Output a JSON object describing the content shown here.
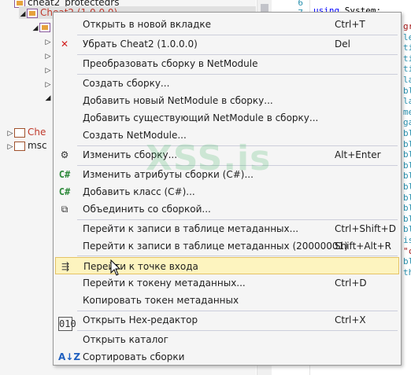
{
  "tree": {
    "nodes": [
      {
        "label": "cheat2_protectedrs",
        "glyph": "",
        "icon": "asm",
        "indent": 0,
        "color": "normal"
      },
      {
        "label": "Cheat2 (1.0.0.0)",
        "glyph": "◢",
        "icon": "asm",
        "indent": 1,
        "color": "red"
      },
      {
        "label": "",
        "glyph": "◢",
        "icon": "asm",
        "indent": 2,
        "color": "normal"
      },
      {
        "label": "",
        "glyph": "▷",
        "icon": "ns",
        "indent": 3,
        "color": "normal"
      },
      {
        "label": "",
        "glyph": "▷",
        "icon": "ns",
        "indent": 3,
        "color": "normal"
      },
      {
        "label": "",
        "glyph": "▷",
        "icon": "ns",
        "indent": 3,
        "color": "normal"
      },
      {
        "label": "",
        "glyph": "▷",
        "icon": "ns",
        "indent": 3,
        "color": "normal"
      },
      {
        "label": "",
        "glyph": "◢",
        "icon": "ns",
        "indent": 3,
        "color": "normal"
      },
      {
        "label": "Che",
        "glyph": "▷",
        "icon": "brown",
        "indent": 0,
        "color": "red"
      },
      {
        "label": "msc",
        "glyph": "▷",
        "icon": "brown",
        "indent": 0,
        "color": "normal"
      }
    ]
  },
  "code": {
    "line_numbers": [
      "6",
      "7"
    ],
    "top_line": {
      "keyword": "using",
      "rest": " System;"
    },
    "fragments": [
      {
        "text": "gr",
        "color": "#a31515"
      },
      {
        "text": "le",
        "color": "#2b91af"
      },
      {
        "text": "ti",
        "color": "#2b91af"
      },
      {
        "text": "ti",
        "color": "#2b91af"
      },
      {
        "text": "ti",
        "color": "#2b91af"
      },
      {
        "text": "la",
        "color": "#2b91af"
      },
      {
        "text": "bl",
        "color": "#2b91af"
      },
      {
        "text": "la",
        "color": "#2b91af"
      },
      {
        "text": "me",
        "color": "#2b91af"
      },
      {
        "text": "ga",
        "color": "#2b91af"
      },
      {
        "text": "bl",
        "color": "#2b91af"
      },
      {
        "text": "bl",
        "color": "#2b91af"
      },
      {
        "text": "bl",
        "color": "#2b91af"
      },
      {
        "text": "bl",
        "color": "#2b91af"
      },
      {
        "text": "bl",
        "color": "#2b91af"
      },
      {
        "text": "bl",
        "color": "#2b91af"
      },
      {
        "text": "bl",
        "color": "#2b91af"
      },
      {
        "text": "bl",
        "color": "#2b91af"
      },
      {
        "text": "bl",
        "color": "#2b91af"
      },
      {
        "text": "bl",
        "color": "#2b91af"
      },
      {
        "text": "is",
        "color": "#2b91af"
      },
      {
        "text": "\"c",
        "color": "#a31515"
      },
      {
        "text": "bl",
        "color": "#2b91af"
      },
      {
        "text": "th",
        "color": "#2b91af"
      }
    ]
  },
  "watermark": "XSS.is",
  "menu": {
    "items": [
      {
        "label": "Открыть в новой вкладке",
        "shortcut": "Ctrl+T",
        "icon": "",
        "highlight": false
      },
      {
        "label": "Убрать Cheat2 (1.0.0.0)",
        "shortcut": "Del",
        "icon": "✕",
        "highlight": false
      },
      {
        "label": "Преобразовать сборку в NetModule",
        "shortcut": "",
        "icon": "",
        "highlight": false
      },
      {
        "label": "Создать сборку...",
        "shortcut": "",
        "icon": "",
        "highlight": false
      },
      {
        "label": "Добавить новый NetModule в сборку...",
        "shortcut": "",
        "icon": "",
        "highlight": false
      },
      {
        "label": "Добавить существующий NetModule в сборку...",
        "shortcut": "",
        "icon": "",
        "highlight": false
      },
      {
        "label": "Создать NetModule...",
        "shortcut": "",
        "icon": "",
        "highlight": false
      },
      {
        "label": "Изменить сборку...",
        "shortcut": "Alt+Enter",
        "icon": "⚙",
        "highlight": false
      },
      {
        "label": "Изменить атрибуты сборки (C#)...",
        "shortcut": "",
        "icon": "C#",
        "highlight": false
      },
      {
        "label": "Добавить класс (C#)...",
        "shortcut": "",
        "icon": "C#",
        "highlight": false
      },
      {
        "label": "Объединить со сборкой...",
        "shortcut": "",
        "icon": "⧉",
        "highlight": false
      },
      {
        "label": "Перейти к записи в таблице метаданных...",
        "shortcut": "Ctrl+Shift+D",
        "icon": "",
        "highlight": false
      },
      {
        "label": "Перейти к записи в таблице метаданных (20000001)",
        "shortcut": "Shift+Alt+R",
        "icon": "",
        "highlight": false
      },
      {
        "label": "Перейти к точке входа",
        "shortcut": "",
        "icon": "⇶",
        "highlight": true
      },
      {
        "label": "Перейти к токену метаданных...",
        "shortcut": "Ctrl+D",
        "icon": "",
        "highlight": false
      },
      {
        "label": "Копировать токен метаданных",
        "shortcut": "",
        "icon": "",
        "highlight": false
      },
      {
        "label": "Открыть Hex-редактор",
        "shortcut": "Ctrl+X",
        "icon": "010",
        "highlight": false
      },
      {
        "label": "Открыть каталог",
        "shortcut": "",
        "icon": "",
        "highlight": false
      },
      {
        "label": "Сортировать сборки",
        "shortcut": "",
        "icon": "A↓Z",
        "highlight": false
      }
    ]
  },
  "colors": {
    "menu_bg": "#f5f5f5",
    "highlight_bg": "#fdf4bf",
    "highlight_border": "#e5c365",
    "separator": "#cccedb",
    "remove_icon": "#d21f1f",
    "csharp_icon": "#2f8a3c"
  }
}
